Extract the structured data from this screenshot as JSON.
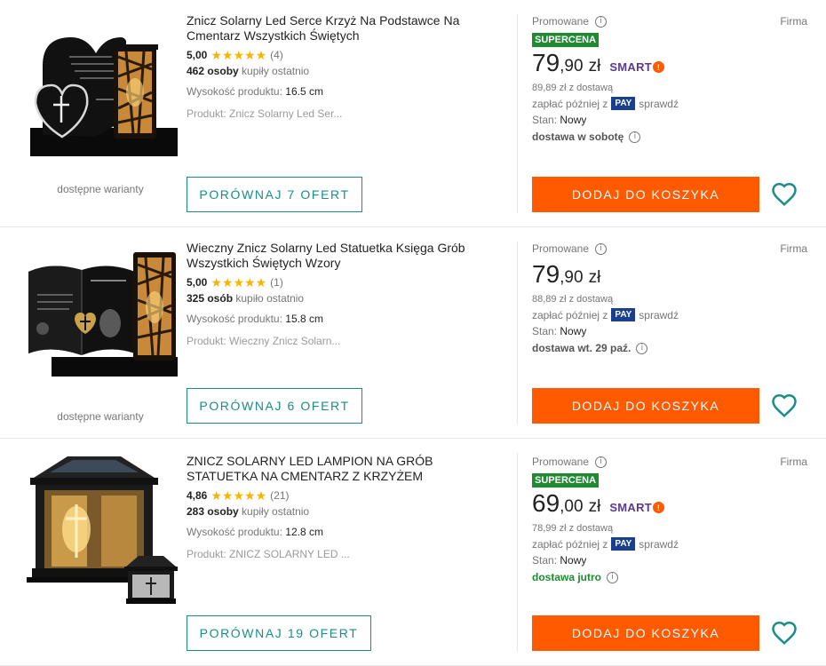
{
  "offers": [
    {
      "title": "Znicz Solarny Led Serce Krzyż Na Podstawce Na Cmentarz Wszystkich Świętych",
      "rating": "5,00",
      "rating_count": "(4)",
      "buyers_count": "462 osoby",
      "buyers_suffix": "kupiły ostatnio",
      "param_label": "Wysokość produktu:",
      "param_value": "16.5 cm",
      "product": "Produkt: Znicz Solarny Led Ser...",
      "variants": "dostępne warianty",
      "compare": "PORÓWNAJ 7 OFERT",
      "promoted": "Promowane",
      "seller_type": "Firma",
      "badge": "SUPERCENA",
      "price_int": "79",
      "price_frac": ",90",
      "currency": "zł",
      "smart": "SMART",
      "price_with_delivery": "89,89 zł z dostawą",
      "pay_later_prefix": "zapłać później z",
      "pay_badge": "PAY",
      "pay_later_suffix": "sprawdź",
      "state_label": "Stan:",
      "state_value": "Nowy",
      "delivery": "dostawa w sobotę",
      "add_to_cart": "DODAJ DO KOSZYKA"
    },
    {
      "title": "Wieczny Znicz Solarny Led Statuetka Księga Grób Wszystkich Świętych Wzory",
      "rating": "5,00",
      "rating_count": "(1)",
      "buyers_count": "325 osób",
      "buyers_suffix": "kupiło ostatnio",
      "param_label": "Wysokość produktu:",
      "param_value": "15.8 cm",
      "product": "Produkt: Wieczny Znicz Solarn...",
      "variants": "dostępne warianty",
      "compare": "PORÓWNAJ 6 OFERT",
      "promoted": "Promowane",
      "seller_type": "Firma",
      "price_int": "79",
      "price_frac": ",90",
      "currency": "zł",
      "price_with_delivery": "88,89 zł z dostawą",
      "pay_later_prefix": "zapłać później z",
      "pay_badge": "PAY",
      "pay_later_suffix": "sprawdź",
      "state_label": "Stan:",
      "state_value": "Nowy",
      "delivery": "dostawa wt. 29 paź.",
      "add_to_cart": "DODAJ DO KOSZYKA"
    },
    {
      "title": "ZNICZ SOLARNY LED LAMPION NA GRÓB STATUETKA NA CMENTARZ Z KRZYŻEM",
      "rating": "4,86",
      "rating_count": "(21)",
      "buyers_count": "283 osoby",
      "buyers_suffix": "kupiły ostatnio",
      "param_label": "Wysokość produktu:",
      "param_value": "12.8 cm",
      "product": "Produkt: ZNICZ SOLARNY LED ...",
      "compare": "PORÓWNAJ 19 OFERT",
      "promoted": "Promowane",
      "seller_type": "Firma",
      "badge": "SUPERCENA",
      "price_int": "69",
      "price_frac": ",00",
      "currency": "zł",
      "smart": "SMART",
      "price_with_delivery": "78,99 zł z dostawą",
      "pay_later_prefix": "zapłać później z",
      "pay_badge": "PAY",
      "pay_later_suffix": "sprawdź",
      "state_label": "Stan:",
      "state_value": "Nowy",
      "delivery": "dostawa jutro",
      "add_to_cart": "DODAJ DO KOSZYKA"
    }
  ],
  "colors": {
    "accent_teal": "#1a8d87",
    "cta_orange": "#ff5a00",
    "badge_green": "#1e8a31",
    "smart_purple": "#5b3a8e",
    "pay_blue": "#1a3f8f",
    "star_yellow": "#f5b600"
  },
  "icons": {
    "info": "info-circle-icon",
    "heart": "heart-outline-icon",
    "star": "star-icon",
    "smart_logo": "smart-logo-icon"
  }
}
